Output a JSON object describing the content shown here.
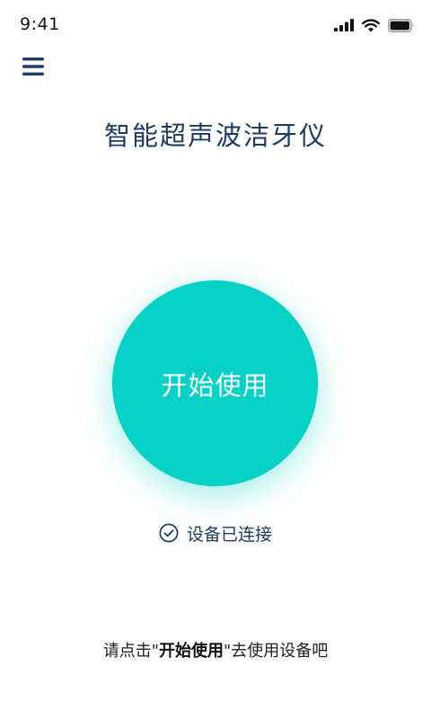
{
  "status_bar": {
    "time": "9:41",
    "icons": [
      "signal-icon",
      "wifi-icon",
      "battery-icon"
    ]
  },
  "header": {
    "menu_icon": "hamburger-menu-icon",
    "title": "智能超声波洁牙仪"
  },
  "main": {
    "start_button_label": "开始使用",
    "connection_status": "设备已连接",
    "connection_icon": "check-circle-icon"
  },
  "footer": {
    "hint_prefix": "请点击\"",
    "hint_emphasis": "开始使用",
    "hint_suffix": "\"去使用设备吧"
  },
  "colors": {
    "accent": "#06d1c7",
    "title": "#1d3b63",
    "background": "#ffffff"
  }
}
